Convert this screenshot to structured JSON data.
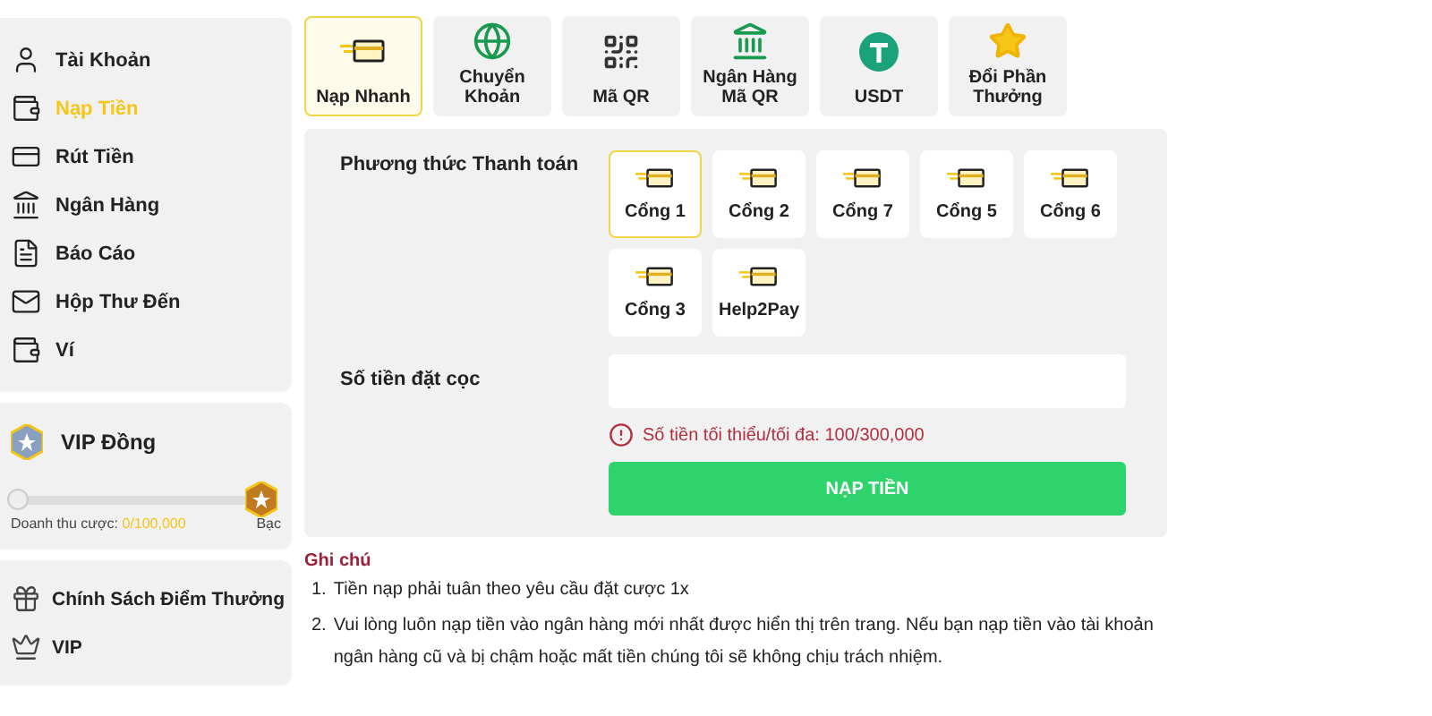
{
  "sidebar": {
    "items": [
      {
        "label": "Tài Khoản",
        "kind": "user",
        "selected": false
      },
      {
        "label": "Nạp Tiền",
        "kind": "wallet",
        "selected": true
      },
      {
        "label": "Rút Tiền",
        "kind": "atm",
        "selected": false
      },
      {
        "label": "Ngân Hàng",
        "kind": "bank",
        "selected": false
      },
      {
        "label": "Báo Cáo",
        "kind": "report",
        "selected": false
      },
      {
        "label": "Hộp Thư Đến",
        "kind": "mail",
        "selected": false
      },
      {
        "label": "Ví",
        "kind": "purse",
        "selected": false
      }
    ]
  },
  "vip": {
    "title": "VIP Đồng",
    "level": 0,
    "turnover_label": "Doanh thu cược:",
    "turnover_value": "0/100,000",
    "next_level": "Bạc"
  },
  "extra_menu": {
    "items": [
      {
        "label": "Chính Sách Điểm Thưởng",
        "kind": "gift"
      },
      {
        "label": "VIP",
        "kind": "crown"
      }
    ]
  },
  "methods": [
    {
      "label": "Nạp Nhanh",
      "kind": "card",
      "selected": true
    },
    {
      "label": "Chuyển Khoản",
      "kind": "globe",
      "selected": false
    },
    {
      "label": "Mã QR",
      "kind": "qr",
      "selected": false
    },
    {
      "label": "Ngân Hàng Mã QR",
      "kind": "bankqr",
      "selected": false
    },
    {
      "label": "USDT",
      "kind": "usdt",
      "selected": false
    },
    {
      "label": "Đổi Phần Thưởng",
      "kind": "star",
      "selected": false
    }
  ],
  "payment": {
    "label": "Phương thức Thanh toán",
    "gateways": [
      {
        "label": "Cổng 1",
        "selected": true
      },
      {
        "label": "Cổng 2",
        "selected": false
      },
      {
        "label": "Cổng 7",
        "selected": false
      },
      {
        "label": "Cổng 5",
        "selected": false
      },
      {
        "label": "Cổng 6",
        "selected": false
      },
      {
        "label": "Cổng 3",
        "selected": false
      },
      {
        "label": "Help2Pay",
        "selected": false
      }
    ]
  },
  "deposit": {
    "label": "Số tiền đặt cọc",
    "hint": "Số tiền tối thiểu/tối đa: 100/300,000",
    "button": "NẠP TIỀN"
  },
  "notes": {
    "title": "Ghi chú",
    "items": [
      {
        "number": "1.",
        "text": "Tiền nạp phải tuân theo yêu cầu đặt cược 1x"
      },
      {
        "number": "2.",
        "text": "Vui lòng luôn nạp tiền vào ngân hàng mới nhất được hiển thị trên trang. Nếu bạn nạp tiền vào tài khoản ngân hàng cũ và bị chậm hoặc mất tiền chúng tôi sẽ không chịu trách nhiệm."
      }
    ]
  }
}
